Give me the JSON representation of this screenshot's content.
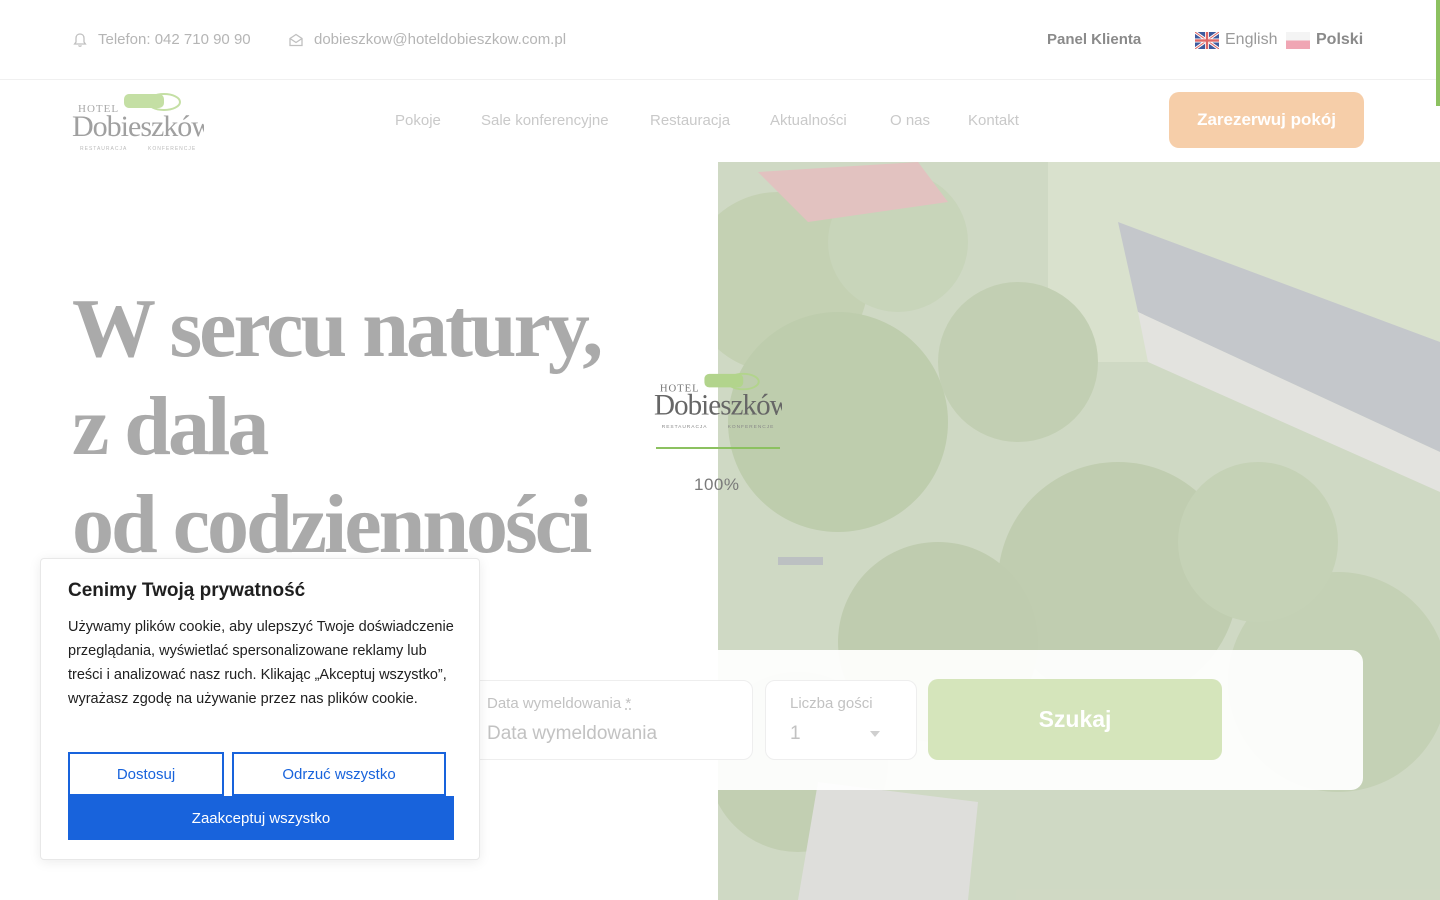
{
  "topbar": {
    "phone": "Telefon: 042 710 90 90",
    "email": "dobieszkow@hoteldobieszkow.com.pl",
    "panel": "Panel Klienta",
    "lang_en": "English",
    "lang_pl": "Polski"
  },
  "logo": {
    "hotel": "HOTEL",
    "name": "Dobieszków",
    "sub_left": "RESTAURACJA",
    "sub_right": "KONFERENCJE"
  },
  "nav": {
    "items": [
      "Pokoje",
      "Sale konferencyjne",
      "Restauracja",
      "Aktualności",
      "O nas",
      "Kontakt"
    ],
    "book": "Zarezerwuj pokój"
  },
  "hero": {
    "line1": "W sercu natury,",
    "line2": "z dala",
    "line3": "od codzienności"
  },
  "loader": {
    "percent": "100%"
  },
  "booking": {
    "checkout_label": "Data wymeldowania",
    "checkout_required": "*",
    "checkout_placeholder": "Data wymeldowania",
    "guests_label": "Liczba gości",
    "guests_value": "1",
    "search": "Szukaj"
  },
  "cookie": {
    "title": "Cenimy Twoją prywatność",
    "text": "Używamy plików cookie, aby ulepszyć Twoje doświadczenie przeglądania, wyświetlać spersonalizowane reklamy lub treści i analizować nasz ruch. Klikając „Akceptuj wszystko”, wyrażasz zgodę na używanie przez nas plików cookie.",
    "customize": "Dostosuj",
    "reject": "Odrzuć wszystko",
    "accept": "Zaakceptuj wszystko"
  },
  "colors": {
    "accent_green": "#8cc160",
    "book_button": "#f6cea9",
    "search_button": "#d5e5bb",
    "cookie_blue": "#1863dc"
  }
}
